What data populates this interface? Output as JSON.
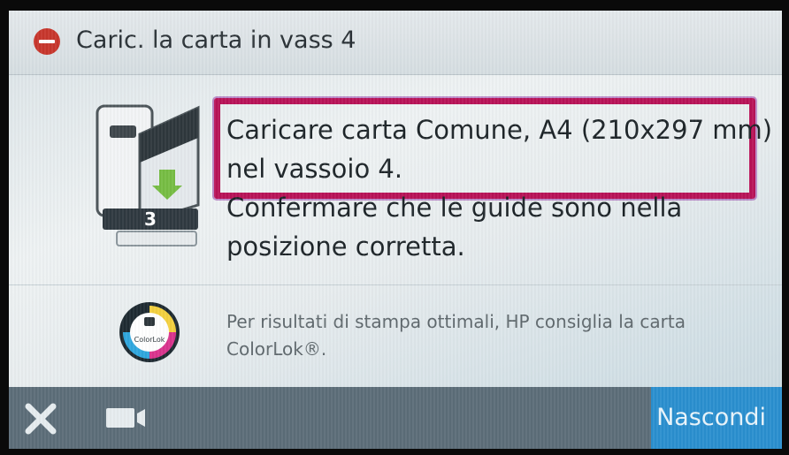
{
  "header": {
    "title": "Caric. la carta in vass 4",
    "icon": "error-icon"
  },
  "message": {
    "line1": "Caricare carta Comune, A4 (210x297 mm)",
    "line2": "nel vassoio 4.",
    "line3": "Confermare che le guide sono nella",
    "line4": "posizione corretta."
  },
  "illustration": {
    "tray_number": "3"
  },
  "tip": {
    "text": "Per risultati di stampa ottimali, HP consiglia la carta ColorLok®.",
    "logo_text": "ColorLok"
  },
  "footer": {
    "close_icon": "close-icon",
    "video_icon": "video-icon",
    "hide_label": "Nascondi"
  },
  "colors": {
    "error": "#c7362c",
    "highlight": "#b81257",
    "footer": "#5c6d78",
    "accent": "#2a8fcf"
  }
}
